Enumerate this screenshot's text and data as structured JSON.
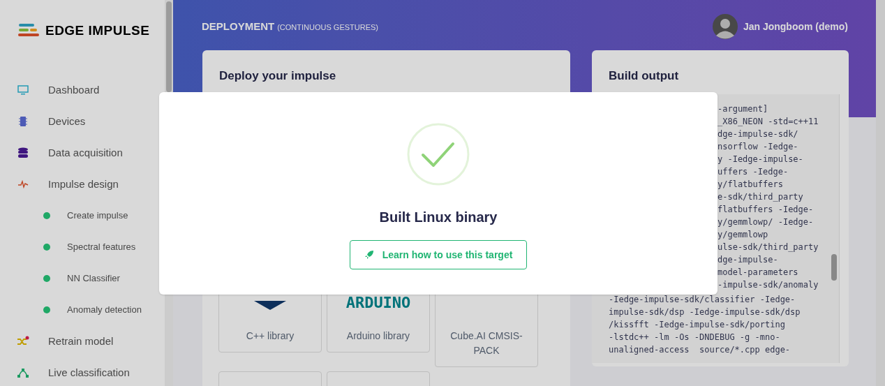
{
  "brand": {
    "name": "EDGE IMPULSE"
  },
  "sidebar": {
    "items": [
      {
        "label": "Dashboard"
      },
      {
        "label": "Devices"
      },
      {
        "label": "Data acquisition"
      },
      {
        "label": "Impulse design",
        "children": [
          {
            "label": "Create impulse",
            "color": "#1fa866"
          },
          {
            "label": "Spectral features",
            "color": "#1fa866"
          },
          {
            "label": "NN Classifier",
            "color": "#1fa866"
          },
          {
            "label": "Anomaly detection",
            "color": "#1fa866"
          }
        ]
      },
      {
        "label": "Retrain model"
      },
      {
        "label": "Live classification"
      }
    ]
  },
  "header": {
    "title": "DEPLOYMENT",
    "subtitle": "(CONTINUOUS GESTURES)",
    "user": "Jan Jongboom (demo)"
  },
  "deploy_panel": {
    "title": "Deploy your impulse",
    "cards": [
      {
        "label": "C++ library"
      },
      {
        "label": "Arduino library",
        "logo_text": "ARDUINO"
      },
      {
        "label": "Cube.AI CMSIS-PACK"
      }
    ]
  },
  "build_output": {
    "title": "Build output",
    "lines_beside_dialog": [
      "-argument]",
      "_X86_NEON -std=c++11",
      "dge-impulse-sdk/",
      "nsorflow -Iedge-",
      "y -Iedge-impulse-",
      "uffers -Iedge-",
      "y/flatbuffers",
      "e-sdk/third_party",
      "flatbuffers -Iedge-",
      "y/gemmlowp/ -Iedge-",
      "y/gemmlowp",
      "ulse-sdk/third_party",
      "dge-impulse-",
      "model-parameters",
      "-impulse-sdk/anomaly"
    ],
    "lines": [
      "-Iedge-impulse-sdk/classifier -Iedge-",
      "impulse-sdk/dsp -Iedge-impulse-sdk/dsp",
      "/kissfft -Iedge-impulse-sdk/porting",
      "-lstdc++ -lm -Os -DNDEBUG -g -mno-",
      "unaligned-access  source/*.cpp edge-"
    ]
  },
  "dialog": {
    "title": "Built Linux binary",
    "button": "Learn how to use this target"
  }
}
